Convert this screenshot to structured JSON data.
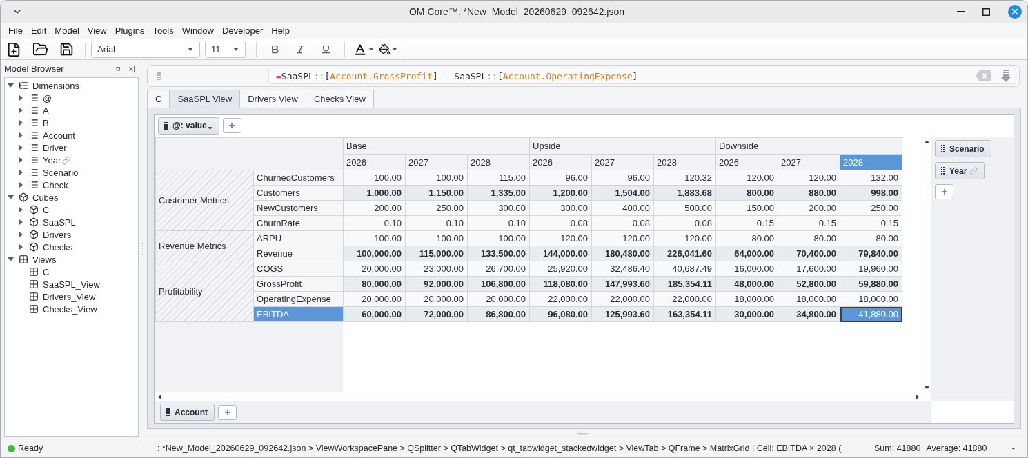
{
  "window": {
    "title": "OM Core™: *New_Model_20260629_092642.json"
  },
  "menu": [
    "File",
    "Edit",
    "Model",
    "View",
    "Plugins",
    "Tools",
    "Window",
    "Developer",
    "Help"
  ],
  "toolbar": {
    "font": "Arial",
    "size": "11"
  },
  "browser": {
    "title": "Model Browser",
    "tree": [
      {
        "label": "Dimensions",
        "kind": "hierarchy",
        "expanded": true,
        "linked": false,
        "children": [
          {
            "label": "@",
            "kind": "dimension",
            "expanded": false,
            "linked": false
          },
          {
            "label": "A",
            "kind": "dimension",
            "expanded": false,
            "linked": false
          },
          {
            "label": "B",
            "kind": "dimension",
            "expanded": false,
            "linked": false
          },
          {
            "label": "Account",
            "kind": "dimension",
            "expanded": false,
            "linked": false
          },
          {
            "label": "Driver",
            "kind": "dimension",
            "expanded": false,
            "linked": false
          },
          {
            "label": "Year",
            "kind": "dimension",
            "expanded": false,
            "linked": true
          },
          {
            "label": "Scenario",
            "kind": "dimension",
            "expanded": false,
            "linked": false
          },
          {
            "label": "Check",
            "kind": "dimension",
            "expanded": false,
            "linked": false
          }
        ]
      },
      {
        "label": "Cubes",
        "kind": "cube",
        "expanded": true,
        "linked": false,
        "children": [
          {
            "label": "C",
            "kind": "cube",
            "expanded": false,
            "linked": false
          },
          {
            "label": "SaaSPL",
            "kind": "cube",
            "expanded": false,
            "linked": false
          },
          {
            "label": "Drivers",
            "kind": "cube",
            "expanded": false,
            "linked": false
          },
          {
            "label": "Checks",
            "kind": "cube",
            "expanded": false,
            "linked": false
          }
        ]
      },
      {
        "label": "Views",
        "kind": "view",
        "expanded": true,
        "linked": false,
        "children": [
          {
            "label": "C",
            "kind": "view",
            "linked": false
          },
          {
            "label": "SaaSPL_View",
            "kind": "view",
            "linked": false
          },
          {
            "label": "Drivers_View",
            "kind": "view",
            "linked": false
          },
          {
            "label": "Checks_View",
            "kind": "view",
            "linked": false
          }
        ]
      }
    ]
  },
  "formula": {
    "tokens": [
      {
        "kind": "operator",
        "text": "="
      },
      {
        "kind": "name",
        "text": "SaaSPL"
      },
      {
        "kind": "separator",
        "text": "::"
      },
      {
        "kind": "bracket",
        "text": "["
      },
      {
        "kind": "reference",
        "text": "Account.GrossProfit"
      },
      {
        "kind": "bracket",
        "text": "]"
      },
      {
        "kind": "plain",
        "text": " - "
      },
      {
        "kind": "name",
        "text": "SaaSPL"
      },
      {
        "kind": "separator",
        "text": "::"
      },
      {
        "kind": "bracket",
        "text": "["
      },
      {
        "kind": "reference",
        "text": "Account.OperatingExpense"
      },
      {
        "kind": "bracket",
        "text": "]"
      }
    ]
  },
  "tabs": [
    {
      "label": "C",
      "selected": false
    },
    {
      "label": "SaaSPL View",
      "selected": true
    },
    {
      "label": "Drivers View",
      "selected": false
    },
    {
      "label": "Checks View",
      "selected": false
    }
  ],
  "view": {
    "measure": "@: value",
    "column_dims": [
      {
        "label": "Scenario",
        "linked": false
      },
      {
        "label": "Year",
        "linked": true
      }
    ],
    "row_dims": [
      {
        "label": "Account",
        "linked": false
      }
    ],
    "grid": {
      "column_groups": [
        {
          "label": "Base",
          "columns": [
            {
              "label": "2026",
              "selected": false
            },
            {
              "label": "2027",
              "selected": false
            },
            {
              "label": "2028",
              "selected": false
            }
          ]
        },
        {
          "label": "Upside",
          "columns": [
            {
              "label": "2026",
              "selected": false
            },
            {
              "label": "2027",
              "selected": false
            },
            {
              "label": "2028",
              "selected": false
            }
          ]
        },
        {
          "label": "Downside",
          "columns": [
            {
              "label": "2026",
              "selected": false
            },
            {
              "label": "2027",
              "selected": false
            },
            {
              "label": "2028",
              "selected": true
            }
          ]
        }
      ],
      "row_groups": [
        {
          "label": "Customer Metrics",
          "rows": [
            {
              "label": "ChurnedCustomers",
              "bold": false,
              "selected": false,
              "values": [
                {
                  "text": "100.00",
                  "selected": false
                },
                {
                  "text": "100.00",
                  "selected": false
                },
                {
                  "text": "115.00",
                  "selected": false
                },
                {
                  "text": "96.00",
                  "selected": false
                },
                {
                  "text": "96.00",
                  "selected": false
                },
                {
                  "text": "120.32",
                  "selected": false
                },
                {
                  "text": "120.00",
                  "selected": false
                },
                {
                  "text": "120.00",
                  "selected": false
                },
                {
                  "text": "132.00",
                  "selected": false
                }
              ]
            },
            {
              "label": "Customers",
              "bold": true,
              "selected": false,
              "values": [
                {
                  "text": "1,000.00",
                  "selected": false
                },
                {
                  "text": "1,150.00",
                  "selected": false
                },
                {
                  "text": "1,335.00",
                  "selected": false
                },
                {
                  "text": "1,200.00",
                  "selected": false
                },
                {
                  "text": "1,504.00",
                  "selected": false
                },
                {
                  "text": "1,883.68",
                  "selected": false
                },
                {
                  "text": "800.00",
                  "selected": false
                },
                {
                  "text": "880.00",
                  "selected": false
                },
                {
                  "text": "998.00",
                  "selected": false
                }
              ]
            },
            {
              "label": "NewCustomers",
              "bold": false,
              "selected": false,
              "values": [
                {
                  "text": "200.00",
                  "selected": false
                },
                {
                  "text": "250.00",
                  "selected": false
                },
                {
                  "text": "300.00",
                  "selected": false
                },
                {
                  "text": "300.00",
                  "selected": false
                },
                {
                  "text": "400.00",
                  "selected": false
                },
                {
                  "text": "500.00",
                  "selected": false
                },
                {
                  "text": "150.00",
                  "selected": false
                },
                {
                  "text": "200.00",
                  "selected": false
                },
                {
                  "text": "250.00",
                  "selected": false
                }
              ]
            },
            {
              "label": "ChurnRate",
              "bold": false,
              "selected": false,
              "values": [
                {
                  "text": "0.10",
                  "selected": false
                },
                {
                  "text": "0.10",
                  "selected": false
                },
                {
                  "text": "0.10",
                  "selected": false
                },
                {
                  "text": "0.08",
                  "selected": false
                },
                {
                  "text": "0.08",
                  "selected": false
                },
                {
                  "text": "0.08",
                  "selected": false
                },
                {
                  "text": "0.15",
                  "selected": false
                },
                {
                  "text": "0.15",
                  "selected": false
                },
                {
                  "text": "0.15",
                  "selected": false
                }
              ]
            }
          ]
        },
        {
          "label": "Revenue Metrics",
          "rows": [
            {
              "label": "ARPU",
              "bold": false,
              "selected": false,
              "values": [
                {
                  "text": "100.00",
                  "selected": false
                },
                {
                  "text": "100.00",
                  "selected": false
                },
                {
                  "text": "100.00",
                  "selected": false
                },
                {
                  "text": "120.00",
                  "selected": false
                },
                {
                  "text": "120.00",
                  "selected": false
                },
                {
                  "text": "120.00",
                  "selected": false
                },
                {
                  "text": "80.00",
                  "selected": false
                },
                {
                  "text": "80.00",
                  "selected": false
                },
                {
                  "text": "80.00",
                  "selected": false
                }
              ]
            },
            {
              "label": "Revenue",
              "bold": true,
              "selected": false,
              "values": [
                {
                  "text": "100,000.00",
                  "selected": false
                },
                {
                  "text": "115,000.00",
                  "selected": false
                },
                {
                  "text": "133,500.00",
                  "selected": false
                },
                {
                  "text": "144,000.00",
                  "selected": false
                },
                {
                  "text": "180,480.00",
                  "selected": false
                },
                {
                  "text": "226,041.60",
                  "selected": false
                },
                {
                  "text": "64,000.00",
                  "selected": false
                },
                {
                  "text": "70,400.00",
                  "selected": false
                },
                {
                  "text": "79,840.00",
                  "selected": false
                }
              ]
            }
          ]
        },
        {
          "label": "Profitability",
          "rows": [
            {
              "label": "COGS",
              "bold": false,
              "selected": false,
              "values": [
                {
                  "text": "20,000.00",
                  "selected": false
                },
                {
                  "text": "23,000.00",
                  "selected": false
                },
                {
                  "text": "26,700.00",
                  "selected": false
                },
                {
                  "text": "25,920.00",
                  "selected": false
                },
                {
                  "text": "32,486.40",
                  "selected": false
                },
                {
                  "text": "40,687.49",
                  "selected": false
                },
                {
                  "text": "16,000.00",
                  "selected": false
                },
                {
                  "text": "17,600.00",
                  "selected": false
                },
                {
                  "text": "19,960.00",
                  "selected": false
                }
              ]
            },
            {
              "label": "GrossProfit",
              "bold": true,
              "selected": false,
              "values": [
                {
                  "text": "80,000.00",
                  "selected": false
                },
                {
                  "text": "92,000.00",
                  "selected": false
                },
                {
                  "text": "106,800.00",
                  "selected": false
                },
                {
                  "text": "118,080.00",
                  "selected": false
                },
                {
                  "text": "147,993.60",
                  "selected": false
                },
                {
                  "text": "185,354.11",
                  "selected": false
                },
                {
                  "text": "48,000.00",
                  "selected": false
                },
                {
                  "text": "52,800.00",
                  "selected": false
                },
                {
                  "text": "59,880.00",
                  "selected": false
                }
              ]
            },
            {
              "label": "OperatingExpense",
              "bold": false,
              "selected": false,
              "values": [
                {
                  "text": "20,000.00",
                  "selected": false
                },
                {
                  "text": "20,000.00",
                  "selected": false
                },
                {
                  "text": "20,000.00",
                  "selected": false
                },
                {
                  "text": "22,000.00",
                  "selected": false
                },
                {
                  "text": "22,000.00",
                  "selected": false
                },
                {
                  "text": "22,000.00",
                  "selected": false
                },
                {
                  "text": "18,000.00",
                  "selected": false
                },
                {
                  "text": "18,000.00",
                  "selected": false
                },
                {
                  "text": "18,000.00",
                  "selected": false
                }
              ]
            },
            {
              "label": "EBITDA",
              "bold": true,
              "selected": true,
              "values": [
                {
                  "text": "60,000.00",
                  "selected": false
                },
                {
                  "text": "72,000.00",
                  "selected": false
                },
                {
                  "text": "86,800.00",
                  "selected": false
                },
                {
                  "text": "96,080.00",
                  "selected": false
                },
                {
                  "text": "125,993.60",
                  "selected": false
                },
                {
                  "text": "163,354.11",
                  "selected": false
                },
                {
                  "text": "30,000.00",
                  "selected": false
                },
                {
                  "text": "34,800.00",
                  "selected": false
                },
                {
                  "text": "41,880.00",
                  "selected": true
                }
              ]
            }
          ]
        }
      ]
    }
  },
  "status": {
    "state": "Ready",
    "path": ": *New_Model_20260629_092642.json > ViewWorkspacePane > QSplitter > QTabWidget > qt_tabwidget_stackedwidget > ViewTab > QFrame > MatrixGrid | Cell: EBITDA × 2028 (",
    "sum": "Sum: 41880",
    "average": "Average: 41880",
    "extra": "-"
  }
}
